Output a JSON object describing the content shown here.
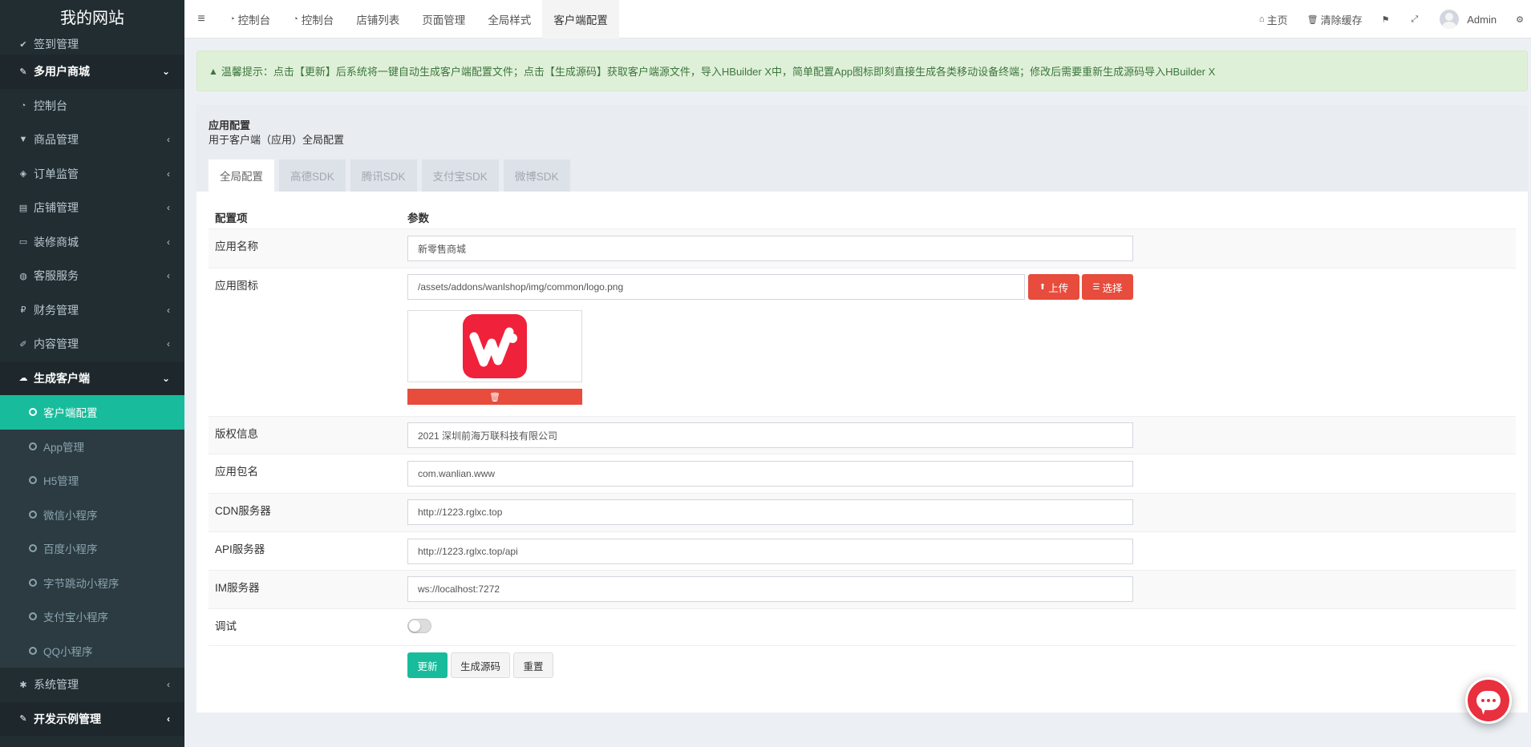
{
  "app": {
    "title": "我的网站"
  },
  "sidebar": {
    "items": [
      {
        "label": "签到管理",
        "icon": "check-icon",
        "type": "item"
      },
      {
        "label": "多用户商城",
        "icon": "magic-wand-icon",
        "type": "header",
        "arrow": "⌄"
      },
      {
        "label": "控制台",
        "icon": "dashboard-icon",
        "type": "item"
      },
      {
        "label": "商品管理",
        "icon": "cart-icon",
        "type": "item",
        "arrow": "‹"
      },
      {
        "label": "订单监管",
        "icon": "cube-icon",
        "type": "item",
        "arrow": "‹"
      },
      {
        "label": "店铺管理",
        "icon": "store-icon",
        "type": "item",
        "arrow": "‹"
      },
      {
        "label": "装修商城",
        "icon": "desktop-icon",
        "type": "item",
        "arrow": "‹"
      },
      {
        "label": "客服服务",
        "icon": "comments-icon",
        "type": "item",
        "arrow": "‹"
      },
      {
        "label": "财务管理",
        "icon": "ruble-icon",
        "type": "item",
        "arrow": "‹"
      },
      {
        "label": "内容管理",
        "icon": "edit-icon",
        "type": "item",
        "arrow": "‹"
      },
      {
        "label": "生成客户端",
        "icon": "cloud-icon",
        "type": "header",
        "arrow": "⌄"
      },
      {
        "label": "客户端配置",
        "type": "sub",
        "active": true
      },
      {
        "label": "App管理",
        "type": "sub"
      },
      {
        "label": "H5管理",
        "type": "sub"
      },
      {
        "label": "微信小程序",
        "type": "sub"
      },
      {
        "label": "百度小程序",
        "type": "sub"
      },
      {
        "label": "字节跳动小程序",
        "type": "sub"
      },
      {
        "label": "支付宝小程序",
        "type": "sub"
      },
      {
        "label": "QQ小程序",
        "type": "sub"
      },
      {
        "label": "系统管理",
        "icon": "gear-icon",
        "type": "item",
        "arrow": "‹"
      },
      {
        "label": "开发示例管理",
        "icon": "magic-wand-icon",
        "type": "header",
        "arrow": "‹"
      }
    ]
  },
  "topnav": {
    "menu_icon": "≡",
    "tabs": [
      {
        "label": "控制台",
        "icon": "dashboard-icon"
      },
      {
        "label": "控制台",
        "icon": "dashboard-icon"
      },
      {
        "label": "店铺列表"
      },
      {
        "label": "页面管理"
      },
      {
        "label": "全局样式"
      },
      {
        "label": "客户端配置",
        "active": true
      }
    ],
    "right": {
      "home": "主页",
      "clear_cache": "清除缓存",
      "user": "Admin"
    }
  },
  "alert": {
    "text": "温馨提示：点击【更新】后系统将一键自动生成客户端配置文件；点击【生成源码】获取客户端源文件，导入HBuilder X中，简单配置App图标即刻直接生成各类移动设备终端；修改后需要重新生成源码导入HBuilder X"
  },
  "panel": {
    "title": "应用配置",
    "subtitle": "用于客户端（应用）全局配置",
    "tabs": [
      "全局配置",
      "高德SDK",
      "腾讯SDK",
      "支付宝SDK",
      "微博SDK"
    ],
    "active_tab": 0
  },
  "form": {
    "head_label": "配置项",
    "head_value": "参数",
    "app_name": {
      "label": "应用名称",
      "value": "新零售商城"
    },
    "app_icon": {
      "label": "应用图标",
      "value": "/assets/addons/wanlshop/img/common/logo.png",
      "upload": "上传",
      "select": "选择"
    },
    "copyright": {
      "label": "版权信息",
      "value": "2021 深圳前海万联科技有限公司"
    },
    "package": {
      "label": "应用包名",
      "value": "com.wanlian.www"
    },
    "cdn": {
      "label": "CDN服务器",
      "value": "http://1223.rglxc.top"
    },
    "api": {
      "label": "API服务器",
      "value": "http://1223.rglxc.top/api"
    },
    "im": {
      "label": "IM服务器",
      "value": "ws://localhost:7272"
    },
    "debug": {
      "label": "调试",
      "enabled": false
    }
  },
  "actions": {
    "update": "更新",
    "generate": "生成源码",
    "reset": "重置"
  },
  "colors": {
    "accent": "#18bc9c",
    "danger": "#e74c3c",
    "sidebar": "#222d32"
  }
}
